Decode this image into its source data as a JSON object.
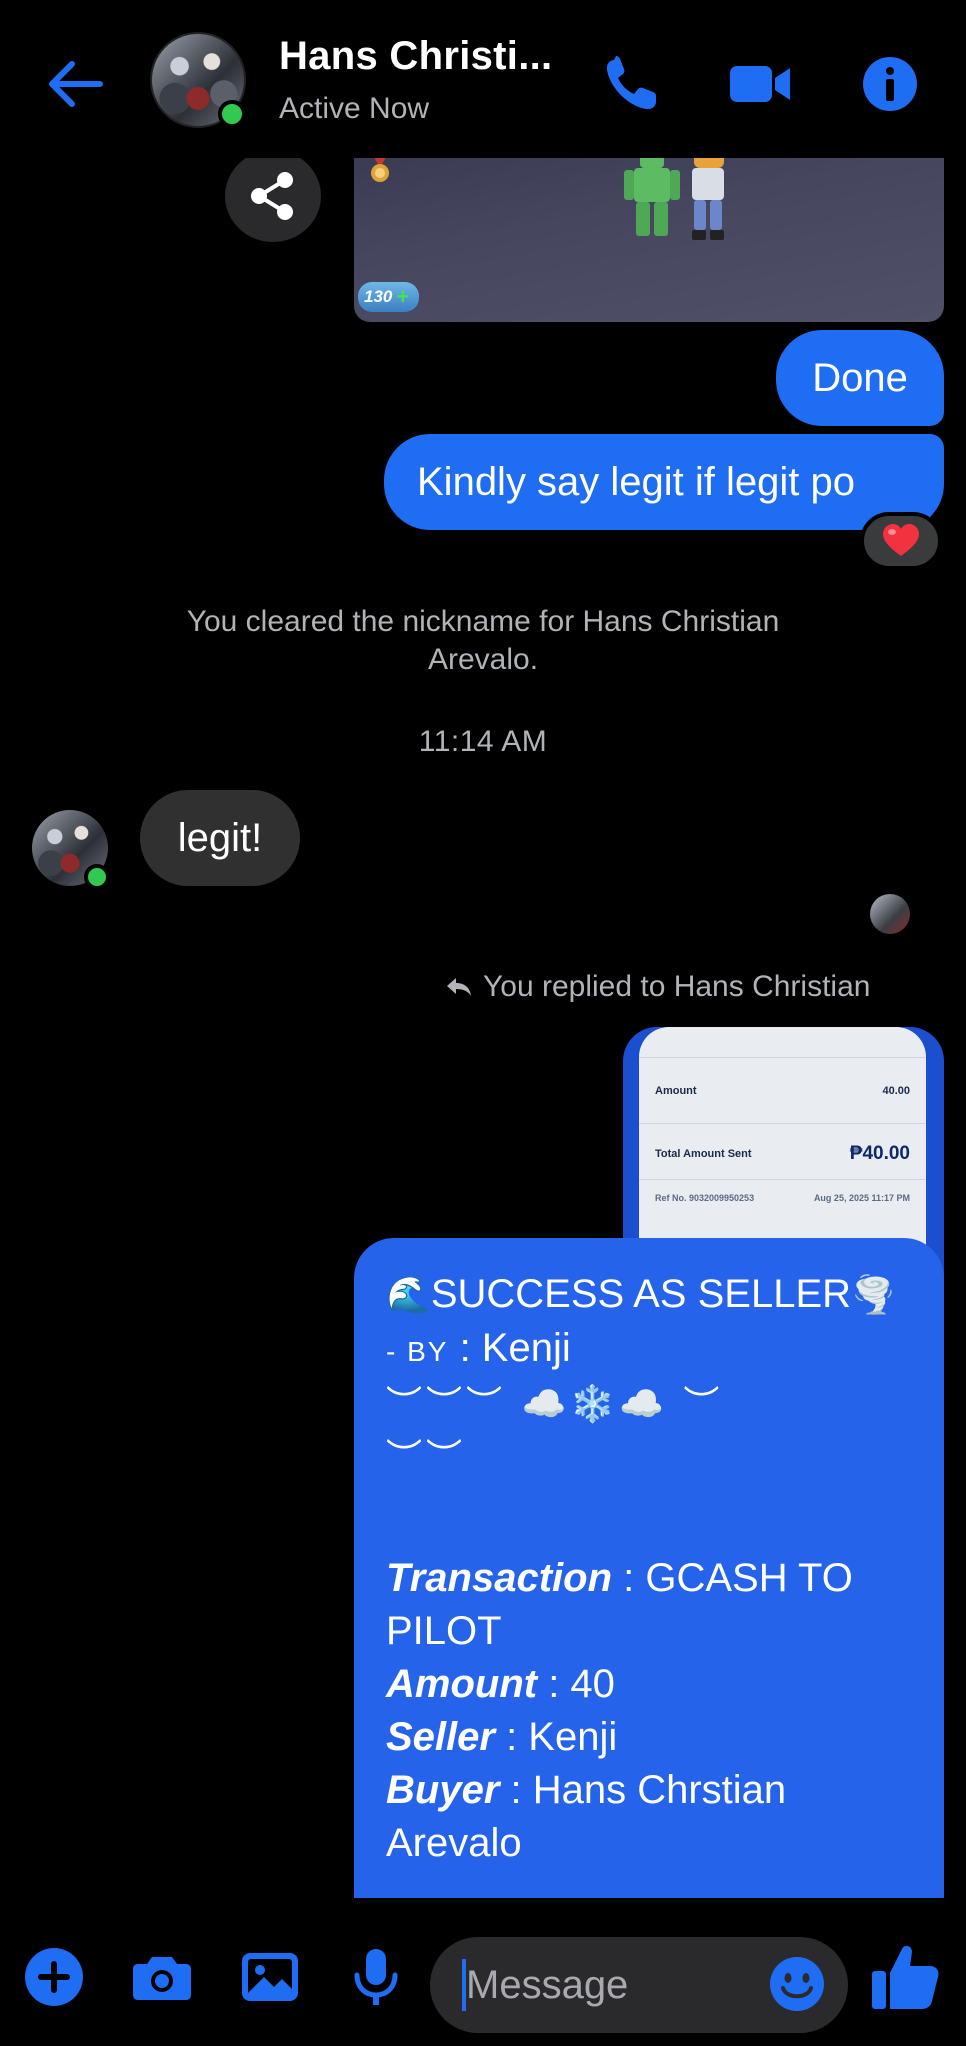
{
  "header": {
    "contact_name": "Hans Christi...",
    "status": "Active Now"
  },
  "game_image": {
    "gem_count": "130"
  },
  "messages": {
    "done": "Done",
    "legit_request": "Kindly say legit if legit po",
    "reaction": "heart",
    "system_note": "You cleared the nickname for Hans Christian Arevalo.",
    "timestamp": "11:14 AM",
    "legit_reply": "legit!",
    "reply_note": "You replied to Hans Christian"
  },
  "receipt": {
    "amount_label": "Amount",
    "amount_value": "40.00",
    "total_label": "Total Amount Sent",
    "total_value": "₱40.00",
    "ref_label": "Ref No. 9032009950253",
    "date": "Aug 25, 2025 11:17 PM"
  },
  "success_message": {
    "title": "SUCCESS AS SELLER",
    "by_prefix": "- BY",
    "by_name": " : Kenji",
    "kaomoji_1": "︶︶︶ ☁️❄️☁️ ︶",
    "kaomoji_2": "︶︶",
    "transaction_label": "Transaction",
    "transaction_value": " : GCASH TO PILOT",
    "amount_label": "Amount",
    "amount_value": " : 40",
    "seller_label": "Seller",
    "seller_value": " : Kenji",
    "buyer_label": "Buyer",
    "buyer_value": " : Hans Chrstian Arevalo"
  },
  "composer": {
    "placeholder": "Message"
  },
  "colors": {
    "accent": "#1f6df2",
    "online": "#31c950",
    "bubble_in": "#303030"
  }
}
